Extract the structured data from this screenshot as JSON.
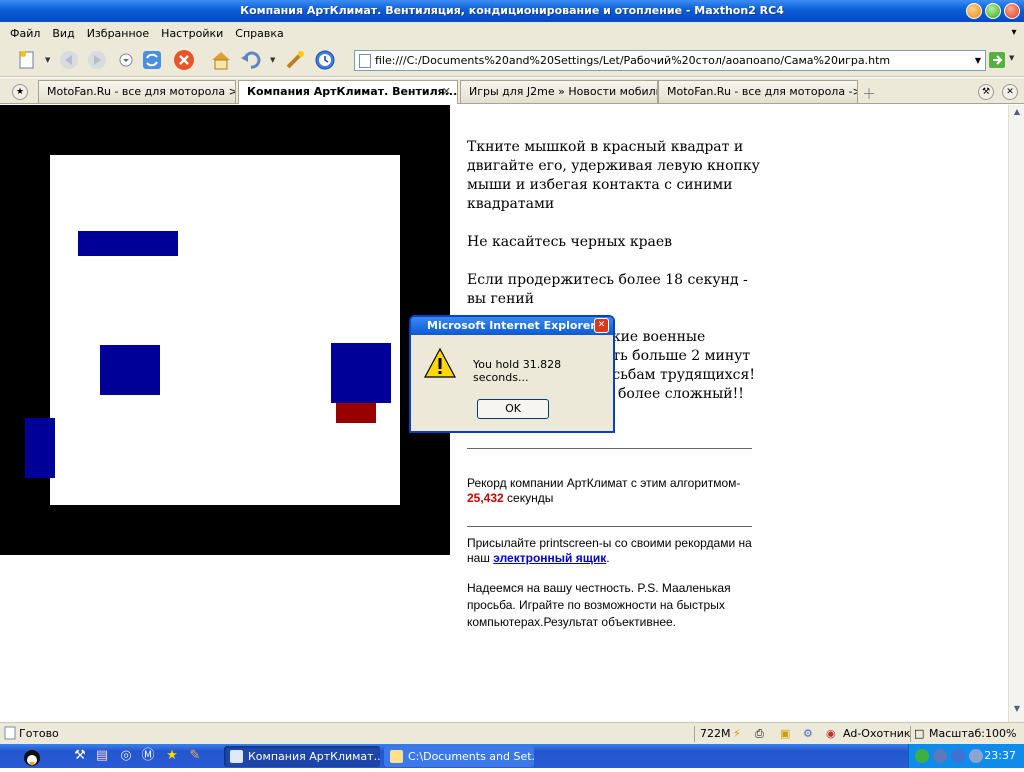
{
  "window": {
    "title": "Компания АртКлимат. Вентиляция, кондиционирование и отопление - Maxthon2 RC4"
  },
  "menu": [
    "Файл",
    "Вид",
    "Избранное",
    "Настройки",
    "Справка"
  ],
  "address": {
    "url": "file:///C:/Documents%20and%20Settings/Let/Рабочий%20стол/аоапоапо/Сама%20игра.htm"
  },
  "tabs": [
    {
      "label": "MotoFan.Ru - все для моторола > ..."
    },
    {
      "label": "Компания АртКлимат. Вентиля..."
    },
    {
      "label": "Игры для J2me » Новости мобиль..."
    },
    {
      "label": "MotoFan.Ru - все для моторола ->..."
    }
  ],
  "page": {
    "instructions": [
      "Ткните мышкой в красный квадрат и двигайте его, удерживая левую кнопку мыши и избегая контакта с синими квадратами",
      "Не касайтесь черных краев",
      "Если продержитесь более 18 секунд - вы гений"
    ],
    "hidden_lines": [
      "ские военные",
      "ать больше 2 минут",
      "осьбам трудящихся!",
      "более сложный!!"
    ],
    "record_prefix": "Рекорд компании АртКлимат с этим алгоритмом-",
    "record_value": "25,432",
    "record_suffix": " секунды",
    "submit_prefix": "Присылайте printscreen-ы со своими рекордами на наш ",
    "submit_link": "электронный ящик",
    "submit_suffix": ".",
    "honesty": "Надеемся на вашу честность. P.S. Мааленькая просьба. Играйте по возможности на быстрых компьютерах.Результат объективнее."
  },
  "dialog": {
    "title": "Microsoft Internet Explorer",
    "message": "You hold 31.828 seconds...",
    "ok_label": "OK"
  },
  "status": {
    "text": "Готово",
    "memory": "722M",
    "adblock": "Ad-Охотник",
    "zoom": "Масштаб:100%"
  },
  "taskbar": {
    "tasks": [
      {
        "label": "Компания АртКлимат...",
        "active": true
      },
      {
        "label": "C:\\Documents and Set...",
        "active": false
      }
    ],
    "clock": "23:37"
  },
  "colors": {
    "block": "#000099",
    "player": "#990000",
    "record": "#cc0000"
  }
}
